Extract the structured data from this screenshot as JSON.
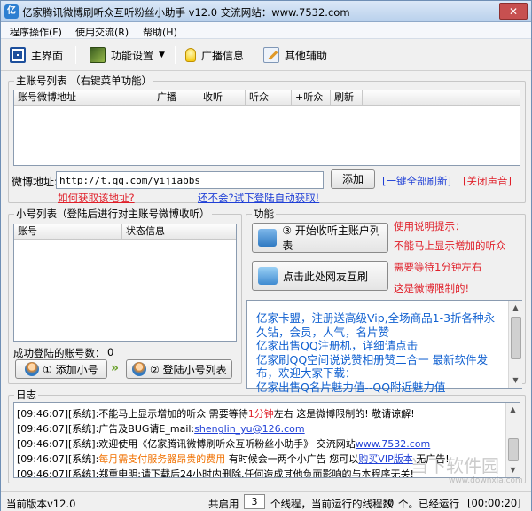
{
  "window": {
    "title": "亿家腾讯微博刷听众互听粉丝小助手 v12.0     交流网站：www.7532.com",
    "app_icon": "亿",
    "minimize": "—",
    "close": "✕"
  },
  "menu": [
    "程序操作(F)",
    "使用交流(R)",
    "帮助(H)"
  ],
  "toolbar": {
    "main": "主界面",
    "settings": "功能设置",
    "broadcast": "广播信息",
    "other": "其他辅助"
  },
  "main_account": {
    "legend": "主账号列表 （右键菜单功能）",
    "columns": [
      "账号微博地址",
      "广播",
      "收听",
      "听众",
      "+听众",
      "刷新"
    ],
    "url_label": "微博地址:",
    "url_value": "http://t.qq.com/yijiabbs",
    "add_button": "添加",
    "refresh_all": "[一键全部刷新]",
    "mute": "[关闭声音]",
    "how_link": "如何获取该地址?",
    "auto_link": "还不会?试下登陆自动获取!"
  },
  "sub_account": {
    "legend": "小号列表（登陆后进行对主账号微博收听）",
    "columns": [
      "账号",
      "状态信息"
    ],
    "success_label": "成功登陆的账号数：",
    "success_count": "0",
    "add_button": "① 添加小号",
    "arrow": "»",
    "login_button": "② 登陆小号列表"
  },
  "function": {
    "legend": "功能",
    "start_button": "③ 开始收听主账户列表",
    "mutual_button": "点击此处网友互刷",
    "tip_title": "使用说明提示：",
    "tips": [
      "不能马上显示增加的听众",
      "需要等待1分钟左右",
      "这是微博限制的!"
    ]
  },
  "ad": "亿家卡盟，注册送高级Vip,全场商品1-3折各种永久钻，会员，人气，名片赞\n亿家出售QQ注册机，详细请点击\n亿家刷QQ空间说说赞相册赞二合一 最新软件发布，欢迎大家下载：\n亿家出售Q名片魅力值--QQ附近魅力值",
  "log": {
    "legend": "日志",
    "lines": [
      {
        "t": "[09:46:07]",
        "s": "[系统]:",
        "m": "不能马上显示增加的听众 需要等待",
        "r": "1分钟",
        "e": "左右 这是微博限制的! 敬请谅解!"
      },
      {
        "t": "[09:46:07]",
        "s": "[系统]:",
        "m": "广告及BUG请E_mail:",
        "l": "shenglin_yu@126.com"
      },
      {
        "t": "[09:46:07]",
        "s": "[系统]:",
        "m": "欢迎使用《亿家腾讯微博刷听众互听粉丝小助手》 交流网站",
        "l": "www.7532.com"
      },
      {
        "t": "[09:46:07]",
        "s": "[系统]:",
        "o": "每月需支付服务器昂贵的费用",
        "m": " 有时候会一两个小广告 您可以",
        "l": "购买VIP版本",
        "e": " 无广告!"
      },
      {
        "t": "[09:46:07]",
        "s": "[系统]:",
        "m": "郑重申明:请下载后24小时内删除,任何造成其他负面影响的与本程序无关!"
      }
    ]
  },
  "status": {
    "version": "当前版本v12.0",
    "total_prefix": "共启用",
    "thread_count": "3",
    "thread_mid": "个线程，当前运行的线程数",
    "running": "0",
    "running_suffix": "个。已经运行",
    "elapsed": "[00:00:20]"
  },
  "watermark": "当下软件园",
  "watermark_sub": "www.downxia.com",
  "colors": {
    "accent": "#1f5fd6",
    "tip_red": "#e0202a",
    "log_orange": "#f07000",
    "link_blue": "#1f3fd6"
  },
  "icons": [
    "app-icon",
    "main-screen-icon",
    "settings-icon",
    "lightbulb-icon",
    "edit-icon",
    "user-icon",
    "network-icon"
  ]
}
